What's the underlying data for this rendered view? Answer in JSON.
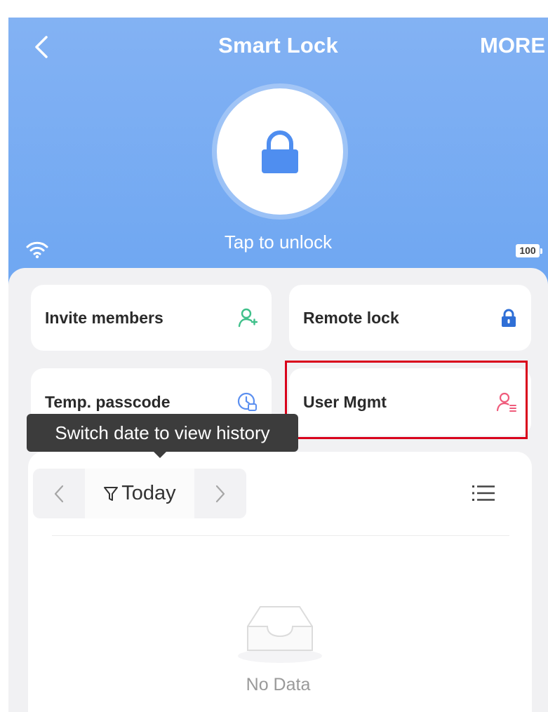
{
  "header": {
    "title": "Smart Lock",
    "more_label": "MORE",
    "back_icon": "chevron-left-icon"
  },
  "lock": {
    "icon": "lock-icon",
    "tap_label": "Tap to unlock",
    "wifi_icon": "wifi-icon",
    "battery_level": "100"
  },
  "cards": [
    {
      "label": "Invite members",
      "icon": "add-user-icon",
      "color": "#3fc08a"
    },
    {
      "label": "Remote lock",
      "icon": "padlock-icon",
      "color": "#2f6fd6"
    },
    {
      "label": "Temp. passcode",
      "icon": "clock-passcode-icon",
      "color": "#5b8ff0"
    },
    {
      "label": "User Mgmt",
      "icon": "user-management-icon",
      "color": "#ef5b7b"
    }
  ],
  "tooltip": {
    "text": "Switch date to view history"
  },
  "history": {
    "date_label": "Today",
    "prev_icon": "chevron-left-icon",
    "next_icon": "chevron-right-icon",
    "filter_icon": "filter-icon",
    "list_icon": "list-icon",
    "empty_text": "No Data",
    "empty_icon": "empty-inbox-icon"
  },
  "colors": {
    "header_gradient_top": "#83b2f3",
    "header_gradient_bottom": "#5f9ef2",
    "panel_bg": "#f1f1f3",
    "highlight": "#d9001b",
    "lock_blue": "#4f8ef0"
  }
}
